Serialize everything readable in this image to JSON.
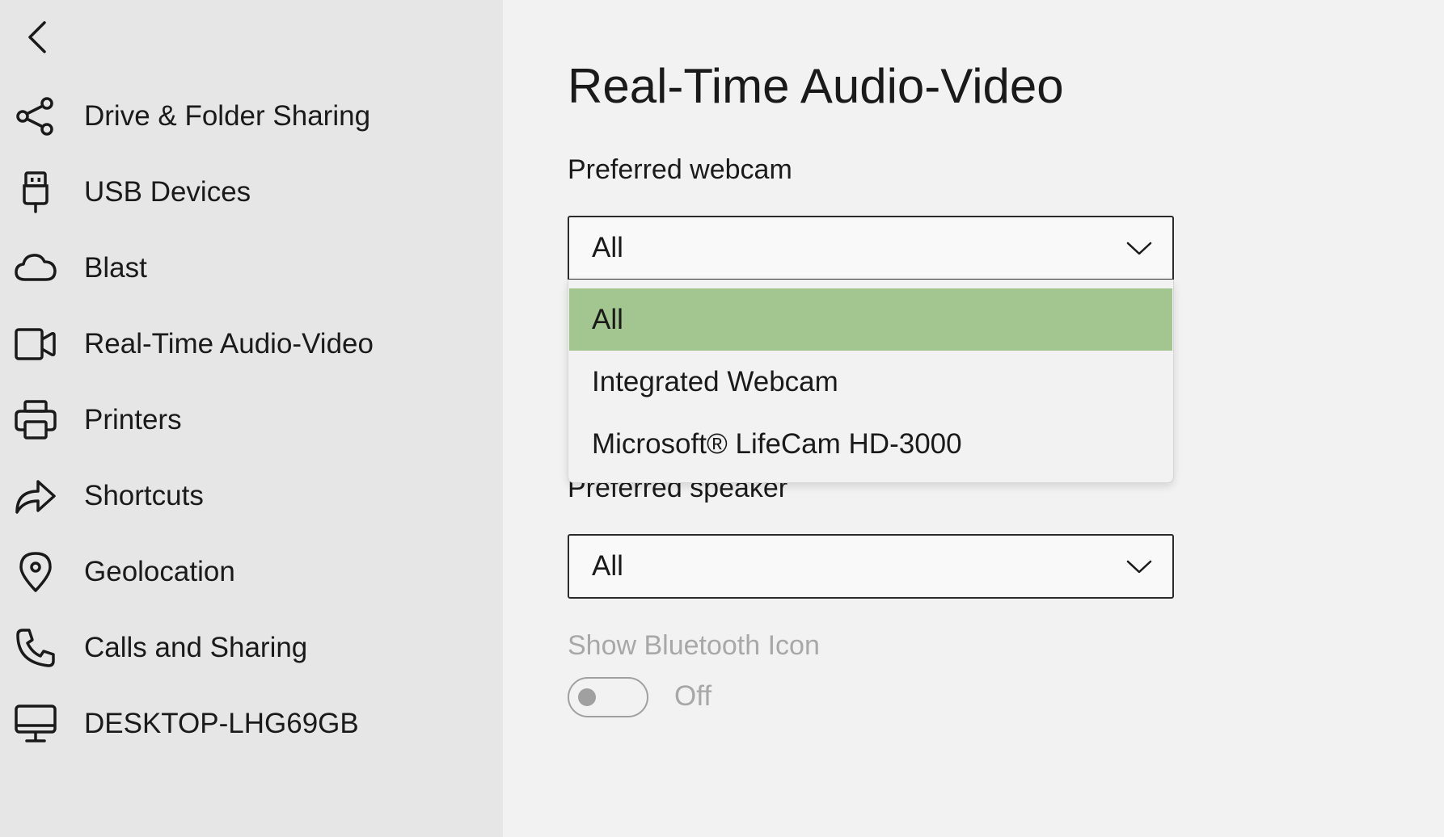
{
  "sidebar": {
    "back_icon": "chevron-left-icon",
    "items": [
      {
        "label": "Drive & Folder Sharing",
        "icon": "share-icon"
      },
      {
        "label": "USB Devices",
        "icon": "usb-icon"
      },
      {
        "label": "Blast",
        "icon": "cloud-icon"
      },
      {
        "label": "Real-Time Audio-Video",
        "icon": "video-camera-icon"
      },
      {
        "label": "Printers",
        "icon": "printer-icon"
      },
      {
        "label": "Shortcuts",
        "icon": "share-arrow-icon"
      },
      {
        "label": "Geolocation",
        "icon": "location-pin-icon"
      },
      {
        "label": "Calls and Sharing",
        "icon": "phone-icon"
      },
      {
        "label": "DESKTOP-LHG69GB",
        "icon": "monitor-icon"
      }
    ]
  },
  "main": {
    "title": "Real-Time Audio-Video",
    "webcam": {
      "label": "Preferred webcam",
      "value": "All",
      "options": [
        "All",
        "Integrated Webcam",
        "Microsoft® LifeCam HD-3000"
      ],
      "selected_index": 0,
      "selected_color": "#a3c690"
    },
    "speaker": {
      "label": "Preferred speaker",
      "value": "All"
    },
    "bluetooth": {
      "label": "Show Bluetooth Icon",
      "state": "Off"
    }
  },
  "colors": {
    "sidebar_bg": "#e6e6e6",
    "main_bg": "#f2f2f2",
    "highlight": "#a3c690",
    "disabled_text": "#a8a8a8"
  }
}
